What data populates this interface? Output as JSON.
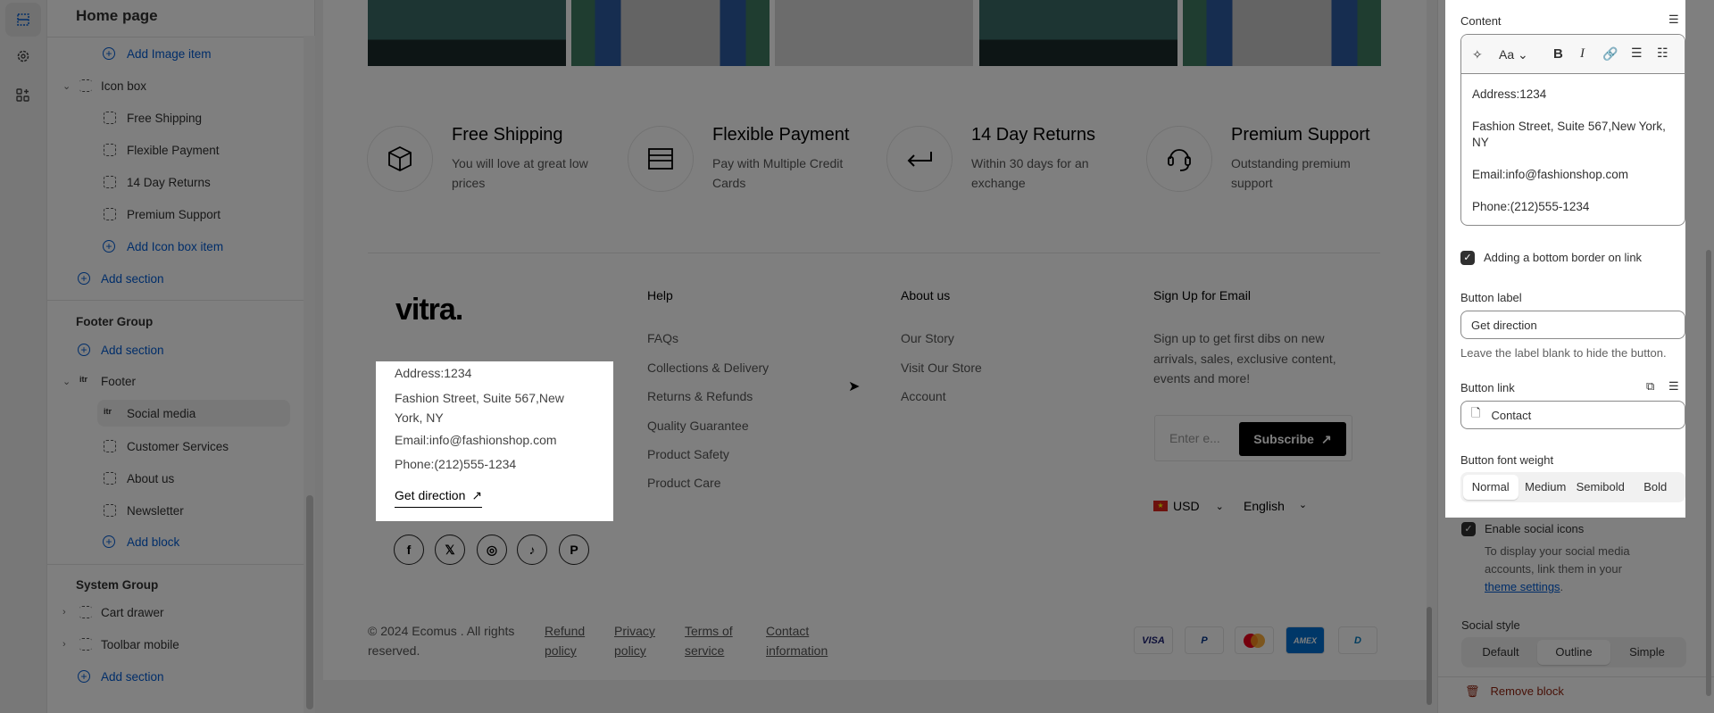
{
  "rail": {
    "icons": [
      "sections-icon",
      "gear-icon",
      "apps-add-icon"
    ]
  },
  "sidebar": {
    "title": "Home page",
    "items": [
      {
        "label": "Add Image item",
        "type": "add"
      },
      {
        "label": "Icon box",
        "type": "section"
      },
      {
        "label": "Free Shipping",
        "type": "block"
      },
      {
        "label": "Flexible Payment",
        "type": "block"
      },
      {
        "label": "14 Day Returns",
        "type": "block"
      },
      {
        "label": "Premium Support",
        "type": "block"
      },
      {
        "label": "Add Icon box item",
        "type": "add"
      },
      {
        "label": "Add section",
        "type": "add"
      }
    ],
    "footer_group": {
      "heading": "Footer Group",
      "add_section": "Add section",
      "footer": "Footer",
      "blocks": [
        "Social media",
        "Customer Services",
        "About us",
        "Newsletter"
      ],
      "add_block": "Add block"
    },
    "system_group": {
      "heading": "System Group",
      "items": [
        "Cart drawer",
        "Toolbar mobile"
      ],
      "add_section": "Add section"
    }
  },
  "preview": {
    "icon_boxes": [
      {
        "title": "Free Shipping",
        "desc": "You will love at great low prices",
        "icon": "box-icon"
      },
      {
        "title": "Flexible Payment",
        "desc": "Pay with Multiple Credit Cards",
        "icon": "credit-card-icon"
      },
      {
        "title": "14 Day Returns",
        "desc": "Within 30 days for an exchange",
        "icon": "return-arrow-icon"
      },
      {
        "title": "Premium Support",
        "desc": "Outstanding premium support",
        "icon": "headset-icon"
      }
    ],
    "footer": {
      "logo": "vitra.",
      "address": {
        "lines": [
          "Address:1234",
          "Fashion Street, Suite 567,New",
          "York, NY",
          "Email:info@fashionshop.com",
          "Phone:(212)555-1234"
        ],
        "button": "Get direction"
      },
      "social": [
        "facebook-icon",
        "x-icon",
        "instagram-icon",
        "tiktok-icon",
        "pinterest-icon"
      ],
      "help": {
        "heading": "Help",
        "links": [
          "FAQs",
          "Collections & Delivery",
          "Returns & Refunds",
          "Quality Guarantee",
          "Product Safety",
          "Product Care"
        ]
      },
      "about": {
        "heading": "About us",
        "links": [
          "Our Story",
          "Visit Our Store",
          "Account"
        ]
      },
      "signup": {
        "heading": "Sign Up for Email",
        "text": [
          "Sign up to get first dibs on new",
          "arrivals, sales, exclusive content,",
          "events and more!"
        ],
        "placeholder": "Enter e...",
        "button": "Subscribe"
      },
      "currency": "USD",
      "language": "English",
      "copyright": [
        "© 2024 Ecomus . All rights",
        "reserved."
      ],
      "policies": [
        [
          "Refund",
          "policy"
        ],
        [
          "Privacy",
          "policy"
        ],
        [
          "Terms of",
          "service"
        ],
        [
          "Contact",
          "information"
        ]
      ],
      "payments": [
        "VISA",
        "P",
        "MC",
        "AMEX",
        "D"
      ]
    }
  },
  "panel": {
    "content_label": "Content",
    "content_lines": [
      "Address:1234",
      "Fashion Street, Suite 567,New York, NY",
      "Email:info@fashionshop.com",
      "Phone:(212)555-1234"
    ],
    "bottom_border_label": "Adding a bottom border on link",
    "bottom_border_checked": true,
    "button_label_label": "Button label",
    "button_label_value": "Get direction",
    "button_label_help": "Leave the label blank to hide the button.",
    "button_link_label": "Button link",
    "button_link_value": "Contact",
    "font_weight_label": "Button font weight",
    "font_weights": [
      "Normal",
      "Medium",
      "Semibold",
      "Bold"
    ],
    "font_weight_selected": "Normal",
    "social_icons_label": "Enable social icons",
    "social_icons_checked": true,
    "social_help": [
      "To display your social media",
      "accounts, link them in your"
    ],
    "social_help_link": "theme settings",
    "social_style_label": "Social style",
    "social_styles": [
      "Default",
      "Outline",
      "Simple"
    ],
    "social_style_selected": "Outline",
    "remove_block": "Remove block"
  },
  "colors": {
    "accent": "#005bd3",
    "danger": "#8e1f0b",
    "overlay": "rgba(0,0,0,0.5)"
  }
}
